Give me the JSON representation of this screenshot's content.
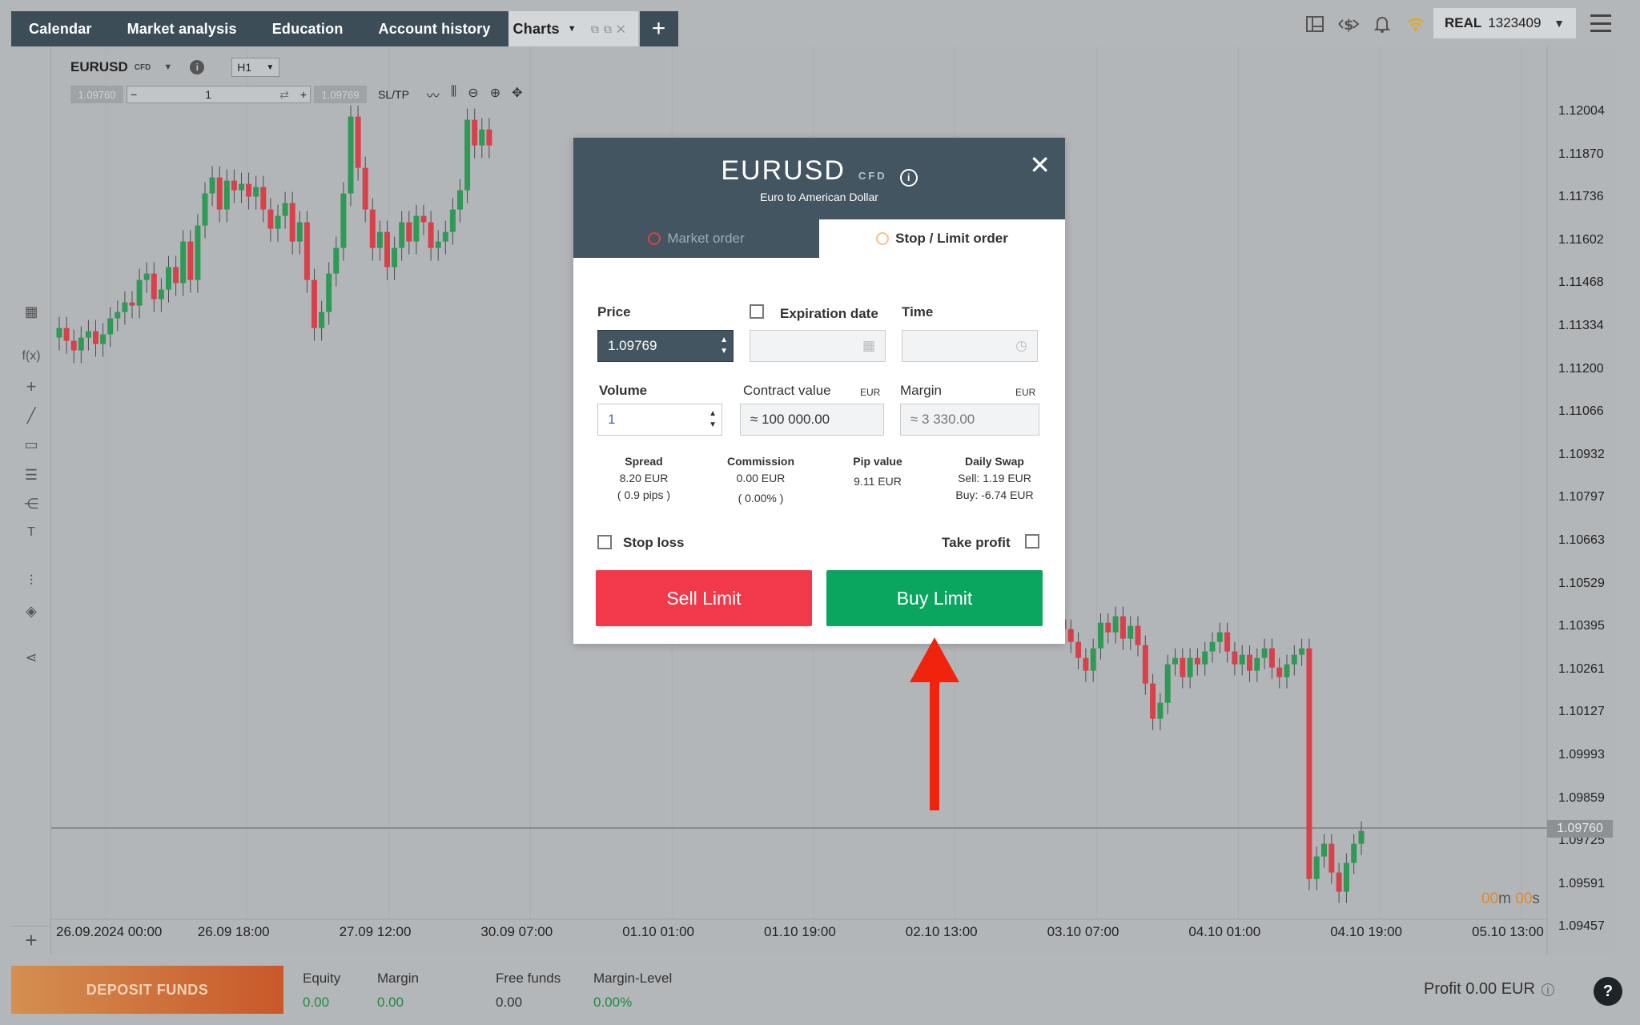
{
  "nav": {
    "tabs": [
      "Calendar",
      "Market analysis",
      "Education",
      "Account history"
    ],
    "active_tab": "Charts",
    "add_tab": "+"
  },
  "account": {
    "type": "REAL",
    "number": "1323409"
  },
  "chart": {
    "symbol": "EURUSD",
    "symbol_type": "CFD",
    "timeframe": "H1",
    "sell_chip": "1.09760",
    "buy_chip": "1.09769",
    "quantity": "1",
    "sltp_label": "SL/TP",
    "current_price": "1.09760",
    "countdown": {
      "m": "00",
      "m_unit": "m",
      "s": "00",
      "s_unit": "s"
    },
    "y_ticks": [
      "1.12004",
      "1.11870",
      "1.11736",
      "1.11602",
      "1.11468",
      "1.11334",
      "1.11200",
      "1.11066",
      "1.10932",
      "1.10797",
      "1.10663",
      "1.10529",
      "1.10395",
      "1.10261",
      "1.10127",
      "1.09993",
      "1.09859",
      "1.09725",
      "1.09591",
      "1.09457"
    ],
    "x_ticks": [
      "26.09.2024 00:00",
      "26.09 18:00",
      "27.09 12:00",
      "30.09 07:00",
      "01.10 01:00",
      "01.10 19:00",
      "02.10 13:00",
      "03.10 07:00",
      "04.10 01:00",
      "04.10 19:00",
      "05.10 13:00"
    ]
  },
  "dialog": {
    "symbol": "EURUSD",
    "type": "CFD",
    "subtitle": "Euro to American Dollar",
    "tabs": {
      "market": "Market order",
      "stop_limit": "Stop / Limit order"
    },
    "price_label": "Price",
    "price_value": "1.09769",
    "expiration_label": "Expiration date",
    "time_label": "Time",
    "volume_label": "Volume",
    "volume_value": "1",
    "contract_label": "Contract value",
    "contract_unit": "EUR",
    "contract_value": "≈ 100 000.00",
    "margin_label": "Margin",
    "margin_unit": "EUR",
    "margin_value": "≈  3 330.00",
    "spread": {
      "label": "Spread",
      "line1": "8.20 EUR",
      "line2": "( 0.9 pips )"
    },
    "commission": {
      "label": "Commission",
      "line1": "0.00 EUR",
      "line2": "( 0.00% )"
    },
    "pip": {
      "label": "Pip value",
      "line1": "9.11 EUR"
    },
    "swap": {
      "label": "Daily Swap",
      "line1": "Sell: 1.19 EUR",
      "line2": "Buy: -6.74 EUR"
    },
    "stop_loss": "Stop loss",
    "take_profit": "Take profit",
    "sell_button": "Sell Limit",
    "buy_button": "Buy Limit"
  },
  "footer": {
    "deposit": "DEPOSIT FUNDS",
    "equity_label": "Equity",
    "equity_value": "0.00",
    "margin_label": "Margin",
    "margin_value": "0.00",
    "free_label": "Free funds",
    "free_value": "0.00",
    "level_label": "Margin-Level",
    "level_value": "0.00%",
    "profit": "Profit 0.00 EUR"
  },
  "colors": {
    "bull": "#2e9a55",
    "bear": "#d8404a",
    "sell": "#f2394a",
    "buy": "#0aa55f",
    "header": "#435560",
    "arrow": "#f2230c"
  }
}
